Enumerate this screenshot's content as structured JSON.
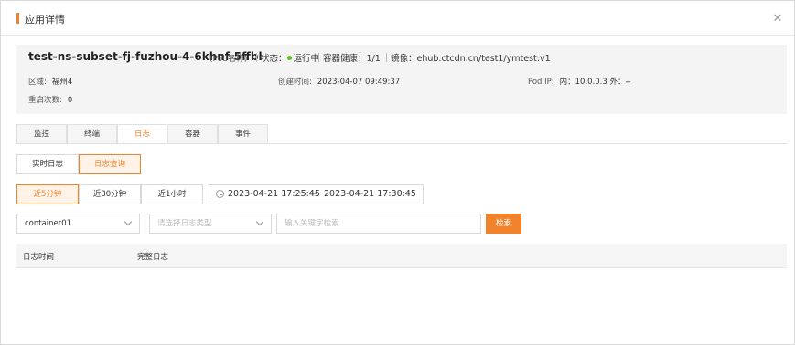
{
  "dialog": {
    "title": "应用详情",
    "close_icon": "close-icon"
  },
  "pod": {
    "name": "test-ns-subset-fj-fuzhou-4-6khnf-5ffbl",
    "tag": "(Pod名称)",
    "status_label": "状态：",
    "status_value": "运行中",
    "health_label": "容器健康：",
    "health_value": "1/1",
    "image_label": "镜像：",
    "image_value": "ehub.ctcdn.cn/test1/ymtest:v1",
    "region_label": "区域:",
    "region_value": "福州4",
    "created_label": "创建时间:",
    "created_value": "2023-04-07 09:49:37",
    "ip_label": "Pod IP:",
    "ip_value": "内：10.0.0.3  外：--",
    "restart_label": "重启次数:",
    "restart_value": "0",
    "status_color": "#52c41a"
  },
  "tabs": [
    {
      "label": "监控"
    },
    {
      "label": "终端"
    },
    {
      "label": "日志",
      "active": true
    },
    {
      "label": "容器"
    },
    {
      "label": "事件"
    }
  ],
  "log_modes": {
    "realtime": "实时日志",
    "query": "日志查询",
    "selected": "日志查询"
  },
  "time_ranges": {
    "r5": "近5分钟",
    "r30": "近30分钟",
    "r60": "近1小时",
    "selected": "近5分钟"
  },
  "date_range": {
    "start": "2023-04-21 17:25:45",
    "sep": "-",
    "end": "2023-04-21 17:30:45"
  },
  "filters": {
    "container_value": "container01",
    "log_type_placeholder": "请选择日志类型",
    "keyword_placeholder": "输入关键字检索",
    "search_label": "检索"
  },
  "table": {
    "col_time": "日志时间",
    "col_full": "完整日志"
  },
  "accent_color": "#f0832b"
}
